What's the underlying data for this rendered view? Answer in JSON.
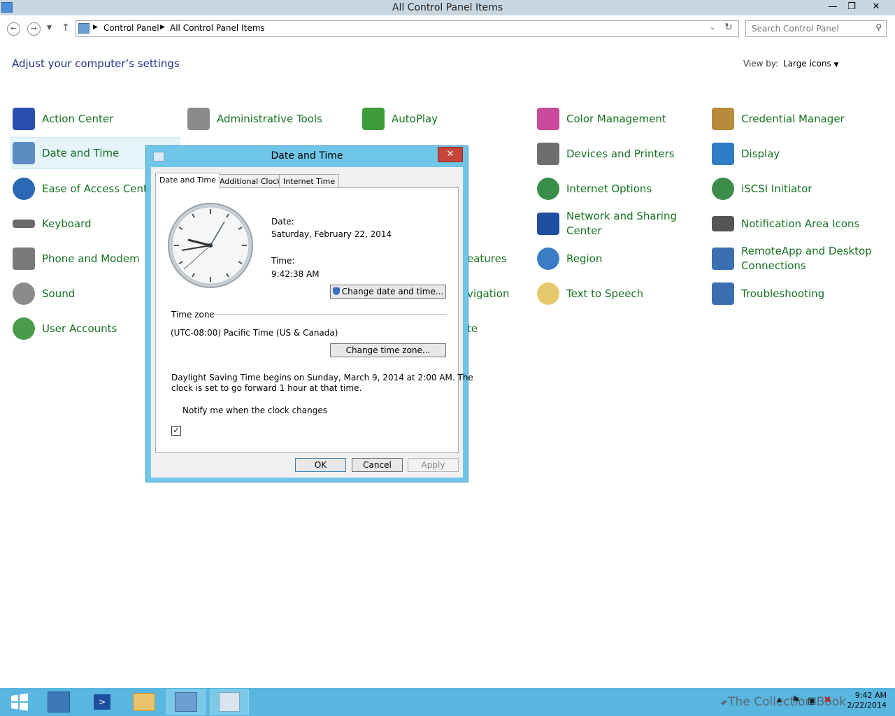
{
  "window": {
    "title": "All Control Panel Items"
  },
  "address": {
    "crumbs": [
      "Control Panel",
      "All Control Panel Items"
    ]
  },
  "search": {
    "placeholder": "Search Control Panel"
  },
  "header": {
    "heading": "Adjust your computer’s settings",
    "view_by_label": "View by:",
    "view_by_value": "Large icons"
  },
  "items": [
    {
      "label": "Action Center",
      "color": "#2a4fb0"
    },
    {
      "label": "Administrative Tools",
      "color": "#8a8a8a"
    },
    {
      "label": "AutoPlay",
      "color": "#3e9b3a"
    },
    {
      "label": "Color Management",
      "color": "#c94a9c"
    },
    {
      "label": "Credential Manager",
      "color": "#b78b3a"
    },
    {
      "label": "Date and Time",
      "color": "#5b8cc0"
    },
    {
      "label": "Devices and Printers",
      "color": "#6e6e6e"
    },
    {
      "label": "Display",
      "color": "#2f7bc4"
    },
    {
      "label": "Ease of Access Center",
      "color": "#2a67b5"
    },
    {
      "label": "Internet Options",
      "color": "#3a8e4a"
    },
    {
      "label": "iSCSI Initiator",
      "color": "#3a8e4a"
    },
    {
      "label": "Keyboard",
      "color": "#6a6a6a"
    },
    {
      "label": "Network and Sharing Center",
      "color": "#1f4fa0"
    },
    {
      "label": "Notification Area Icons",
      "color": "#555555"
    },
    {
      "label": "Phone and Modem",
      "color": "#7a7a7a"
    },
    {
      "label": "Region",
      "color": "#3b7dc4"
    },
    {
      "label": "RemoteApp and Desktop Connections",
      "color": "#3a6fb2"
    },
    {
      "label": "Sound",
      "color": "#8a8a8a"
    },
    {
      "label": "Text to Speech",
      "color": "#e6c96c"
    },
    {
      "label": "Troubleshooting",
      "color": "#3a6fb2"
    },
    {
      "label": "User Accounts",
      "color": "#4a9c4a"
    }
  ],
  "hidden_fragments": [
    "eatures",
    "vigation",
    "te"
  ],
  "dialog": {
    "title": "Date and Time",
    "tabs": [
      "Date and Time",
      "Additional Clocks",
      "Internet Time"
    ],
    "date_label": "Date:",
    "date_value": "Saturday, February 22, 2014",
    "time_label": "Time:",
    "time_value": "9:42:38 AM",
    "change_dt_button": "Change date and time...",
    "timezone_label": "Time zone",
    "timezone_value": "(UTC-08:00) Pacific Time (US & Canada)",
    "change_tz_button": "Change time zone...",
    "dst_line1": "Daylight Saving Time begins on Sunday, March 9, 2014 at 2:00 AM. The",
    "dst_line2": "clock is set to go forward 1 hour at that time.",
    "notify_label": "Notify me when the clock changes",
    "notify_checked": true,
    "ok": "OK",
    "cancel": "Cancel",
    "apply": "Apply"
  },
  "taskbar": {
    "time": "9:42 AM",
    "date": "2/22/2014",
    "watermark": "The Collection Book"
  },
  "colors": {
    "link_green": "#14721e",
    "heading_blue": "#1e3287",
    "taskbar": "#58b6df",
    "dialog_frame": "#6fc6e8"
  }
}
